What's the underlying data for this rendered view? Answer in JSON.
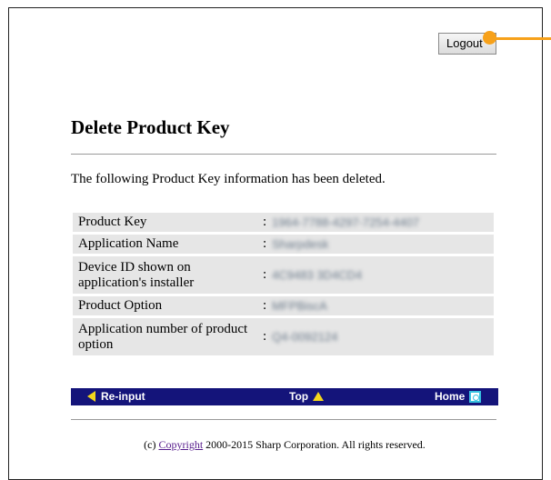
{
  "header": {
    "logout_label": "Logout"
  },
  "page": {
    "title": "Delete Product Key",
    "message": "The following Product Key information has been deleted."
  },
  "table": {
    "rows": [
      {
        "label": "Product Key",
        "value": "1964-7788-4297-7254-4407"
      },
      {
        "label": "Application Name",
        "value": "Sharpdesk"
      },
      {
        "label": "Device ID shown on application's installer",
        "value": "4C9483 3D4CD4"
      },
      {
        "label": "Product Option",
        "value": "MFPBiscA"
      },
      {
        "label": "Application number of product option",
        "value": "Q4-0092124"
      }
    ]
  },
  "nav": {
    "reinput": "Re-input",
    "top": "Top",
    "home": "Home"
  },
  "footer": {
    "prefix": "(c)",
    "link": "Copyright",
    "suffix": "2000-2015 Sharp Corporation. All rights reserved."
  },
  "colors": {
    "nav_bg": "#14147a",
    "arrow": "#f3d51c",
    "pointer": "#f7a11a"
  },
  "icons": [
    "arrow-left-icon",
    "arrow-up-icon",
    "home-icon"
  ]
}
